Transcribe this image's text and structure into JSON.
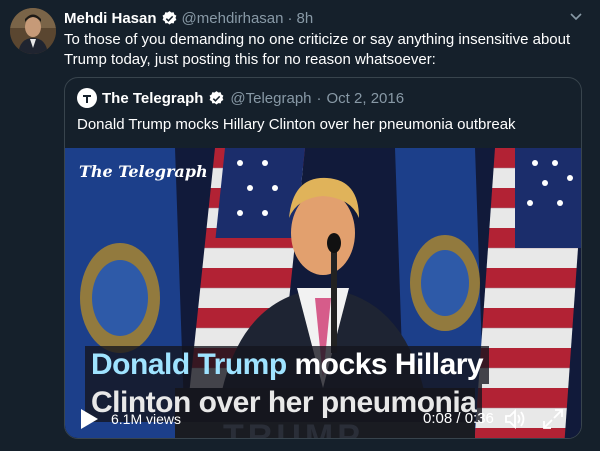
{
  "tweet": {
    "author_name": "Mehdi Hasan",
    "handle": "@mehdirhasan",
    "time": "8h",
    "separator": "·",
    "text": "To those of you demanding no one criticize or say anything insensitive about Trump today, just posting this for no reason whatsoever:"
  },
  "quote": {
    "author_name": "The Telegraph",
    "handle": "@Telegraph",
    "separator": "·",
    "date": "Oct 2, 2016",
    "text": "Donald Trump mocks Hillary Clinton over her pneumonia outbreak",
    "video": {
      "brand_watermark": "The Telegraph",
      "caption_line1_a": "Donald Trump",
      "caption_line1_b": " mocks Hillary",
      "caption_line2": "Clinton over her pneumonia",
      "podium_text": "TRUMP",
      "views": "6.1M views",
      "time": "0:08 / 0:36"
    }
  },
  "icons": {
    "verified": "verified-badge-icon",
    "chevron": "chevron-down-icon",
    "play": "play-icon",
    "volume": "volume-icon",
    "fullscreen": "fullscreen-icon"
  },
  "colors": {
    "background": "#15202b",
    "muted": "#8899a6",
    "verified": "#ffffff",
    "caption_accent": "#9fe3ff"
  }
}
